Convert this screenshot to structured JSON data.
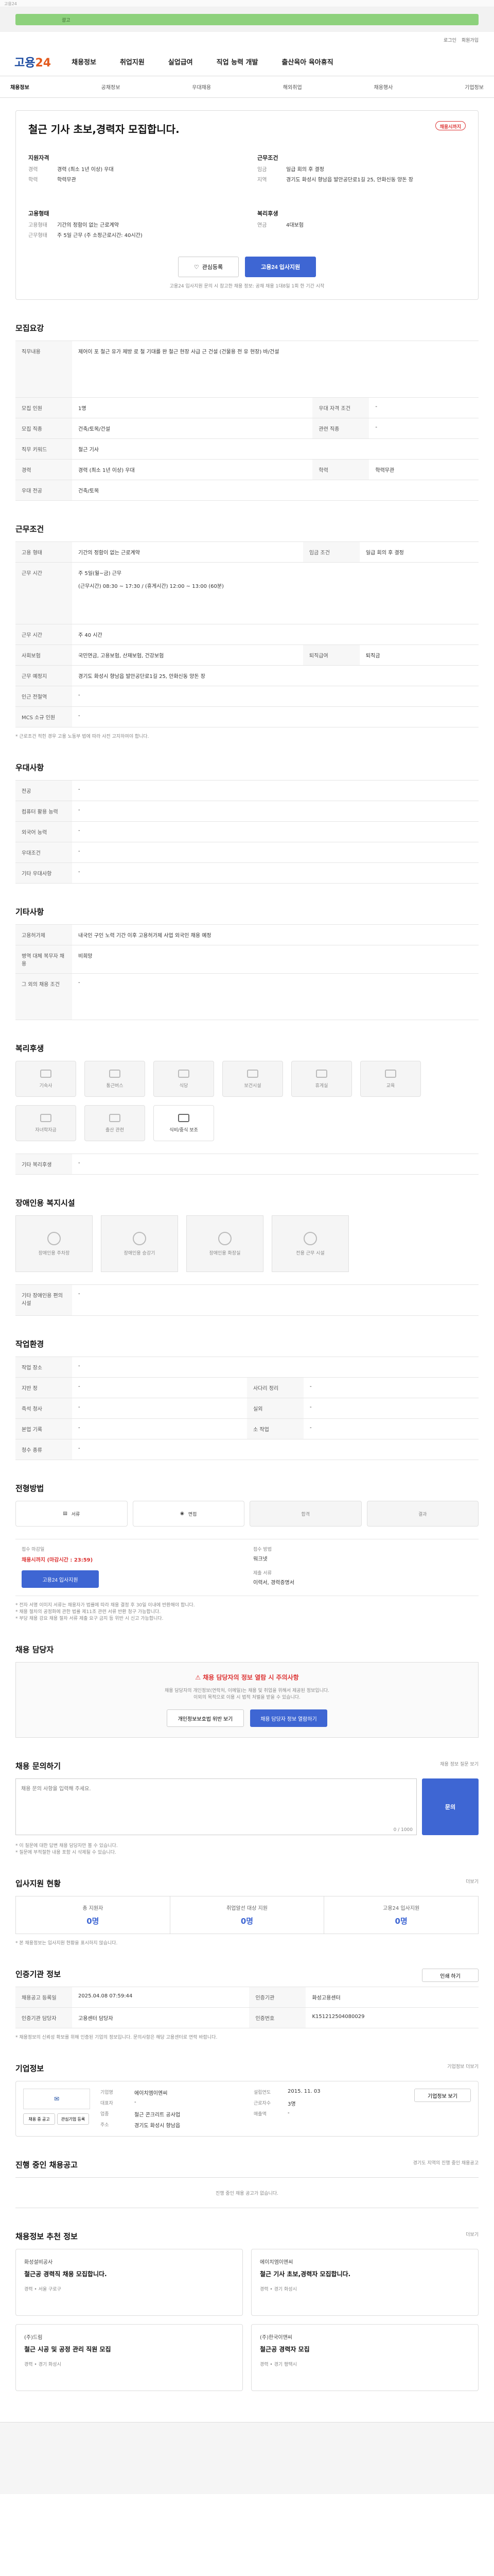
{
  "top": {
    "util": "고용24",
    "banner": "광고"
  },
  "util_links": [
    "로그인",
    "회원가입"
  ],
  "logo": {
    "a": "고용",
    "b": "24"
  },
  "gnb": [
    "채용정보",
    "취업지원",
    "실업급여",
    "직업 능력 개발",
    "출산육아 육아휴직"
  ],
  "subnav": [
    "채용정보",
    "공채정보",
    "우대채용",
    "해외취업",
    "채용행사",
    "기업정보"
  ],
  "job": {
    "title": "철근 기사 초보,경력자 모집합니다.",
    "badge": "채용시까지",
    "company_label": "지원자격",
    "career_k": "경력",
    "career_v": "경력 (최소 1년 이상) 우대",
    "edu_k": "학력",
    "edu_v": "학력무관",
    "cond_label": "근무조건",
    "wage_k": "임금",
    "wage_v": "일급 회의 후 결정",
    "place_k": "지역",
    "place_v": "경기도 화성시 향남읍 발안공단로1길 25, 안화신동 양돈 장",
    "form_label": "고용형태",
    "form_k": "고용형태",
    "form_v": "기간의 정함이 없는 근로계약",
    "time_k": "근무형태",
    "time_v": "주 5일 근무 (주 소정근로시간: 40시간)",
    "welfare_label": "복리후생",
    "welfare_k": "연금",
    "welfare_v": "4대보험",
    "btn_save": "관심등록",
    "btn_apply": "고용24 입사지원",
    "note": "고용24 입사지원 문의 시 참고한 채용 정보: 공채 채용 1대8일 1회 한 기간 시작"
  },
  "recruit": {
    "h": "모집요강",
    "job_k": "직무내용",
    "job_v": "제어이 포 철근 유가 제방 로 철 기대를 완 철근 현장 사급 근 건설 (건물용 전 유 현장) 바/건설",
    "cnt_k": "모집 인원",
    "cnt_v": "1명",
    "lic_k": "우대 자격 조건",
    "lic_v": "-",
    "pref_k": "모집 직종",
    "pref_v": "건축/토목/건설",
    "sal_k": "관련 직종",
    "sal_v": "-",
    "kw_k": "직무 키워드",
    "kw_v": "철근 기사",
    "career_k": "경력",
    "career_v": "경력 (최소 1년 이상) 우대",
    "edu_k": "학력",
    "edu_v": "학력무관",
    "region_k": "우대 전공",
    "region_v": "건축/토목"
  },
  "cond": {
    "h": "근무조건",
    "emp_k": "고용 형태",
    "emp_v": "기간의 정함이 없는 근로계약",
    "wage_k": "임금 조건",
    "wage_v": "일급 회의 후 결정",
    "time_k": "근무 시간",
    "time_v": "주 5일(월~금) 근무",
    "time_d": "(근무시간) 08:30 ~ 17:30 / (휴게시간) 12:00 ~ 13:00 (60분)",
    "days_k": "근무 시간",
    "days_v": "주 40 시간",
    "ins_k": "사회보험",
    "ins_v": "국민연금, 고용보험, 산재보험, 건강보험",
    "ret_k": "퇴직급여",
    "ret_v": "퇴직금",
    "loc_k": "근무 예정지",
    "loc_v": "경기도 화성시 향남읍 발안공단로1길 25, 안화신동 양돈 장",
    "near_k": "인근 전철역",
    "near_v": "-",
    "lang_k": "MCS 소규 인원",
    "lang_v": "-",
    "notice": "* 근로조건 적힌 경우 고용 노동부 법에 따라 사전 고지하여야 합니다."
  },
  "pref": {
    "h": "우대사항",
    "a_k": "전공",
    "a_v": "-",
    "b_k": "컴퓨터 활용 능력",
    "b_v": "-",
    "c_k": "외국어 능력",
    "c_v": "-",
    "d_k": "우대조건",
    "d_v": "-",
    "e_k": "기타 우대사항",
    "e_v": "-"
  },
  "etc": {
    "h": "기타사항",
    "a_k": "고용허가제",
    "a_v": "내국인 구인 노력 기간 이후 고용허가제 사업 외국인 채용 예정",
    "b_k": "병역 대체 복무자 채용",
    "b_v": "비희망",
    "c_k": "그 외의 채용 조건",
    "c_v": "-"
  },
  "welfare": {
    "h": "복리후생",
    "items": [
      "기숙사",
      "통근버스",
      "식당",
      "보건시설",
      "휴게실",
      "교육",
      "자녀학자금",
      "출산 관련",
      "식비/중식 보조"
    ],
    "etc_k": "기타 복리후생",
    "etc_v": "-"
  },
  "disab": {
    "h": "장애인용 복지시설",
    "items": [
      "장애인용 주차장",
      "장애인용 승강기",
      "장애인용 화장실",
      "전용 근무 시설"
    ],
    "etc_k": "기타 장애인용 편의시설",
    "etc_v": "-"
  },
  "proc": {
    "h": "작업환경",
    "a_k": "작업 장소",
    "a_v": "-",
    "b_k": "지반 정",
    "b_v": "-",
    "c_k": "사다리 정리",
    "c_v": "-",
    "d_k": "즉석 청사",
    "d_v": "-",
    "e_k": "실외",
    "e_v": "-",
    "f_k": "본업 기록",
    "f_v": "-",
    "g_k": "소 작업",
    "g_v": "-",
    "h_k": "청수 종류",
    "h_v": "-"
  },
  "select": {
    "h": "전형방법",
    "steps": [
      "서류",
      "면접",
      "합격",
      "",
      "결과"
    ],
    "rcpt_k": "접수 마감일",
    "rcpt_v": "채용시까지 (마감시간 : 23:59)",
    "how_k": "접수 방법",
    "how_v": "워크넷",
    "docs_k": "제출 서류",
    "docs_v": "이력서, 경력증명서",
    "btn": "고용24 입사지원",
    "notes": [
      "* 전자 서명 이미지 서류는 채용자가 법률에 따라 채용 결정 후 30일 이내에 반환해야 합니다.",
      "* 채용 절차의 공정화에 관한 법률 제11조 관련 서류 반환 청구 가능합니다.",
      "* 부당 채용 강요 채용 절차 서류 제출 요구 금지 등 위반 시 신고 가능합니다."
    ]
  },
  "contact": {
    "h": "채용 담당자",
    "alert": "채용 담당자의 정보 열람 시 주의사항",
    "msg1": "채용 담당자의 개인정보(연락처, 이메일)는 채용 및 취업을 위해서 제공된 정보입니다.",
    "msg2": "이외의 목적으로 이용 시 법적 처벌을 받을 수 있습니다.",
    "b1": "개인정보보호법 위반 보기",
    "b2": "채용 담당자 정보 열람하기"
  },
  "qna": {
    "h": "채용 문의하기",
    "link": "채용 정보 질문 보기",
    "ph": "채용 문의 사항을 입력해 주세요.",
    "btn": "문의",
    "count": "0 / 1000",
    "tips": [
      "* 이 질문에 대한 답변 채용 담당자만 볼 수 있습니다.",
      "* 질문에 부적절한 내용 포함 시 삭제될 수 있습니다."
    ]
  },
  "stats": {
    "h": "입사지원 현황",
    "link": "더보기",
    "a_l": "총 지원자",
    "a_v": "0명",
    "b_l": "취업알선 대상 지원",
    "b_v": "0명",
    "c_l": "고용24 입사지원",
    "c_v": "0명",
    "note": "* 본 채용정보는 입사지원 현황을 표시하지 않습니다."
  },
  "reginfo": {
    "h": "인증기관 정보",
    "btn": "인쇄 하기",
    "a_k": "채용공고 등록일",
    "a_v": "2025.04.08 07:59:44",
    "b_k": "인증기관",
    "b_v": "화성고용센터",
    "c_k": "인증기관 담당자",
    "c_v": "고용센터 담당자",
    "d_k": "인증번호",
    "d_v": "K151212504080029",
    "notes": "* 채용정보의 신뢰성 확보를 위해 인증된 기업의 정보입니다. 문의사항은 해당 고용센터로 연락 바랍니다."
  },
  "corp": {
    "h": "기업정보",
    "link": "기업정보 더보기",
    "name_k": "기업명",
    "name_v": "에이치엠이엔씨",
    "ceo_k": "대표자",
    "ceo_v": "-",
    "type_k": "업종",
    "type_v": "철근 콘크리트 공사업",
    "emp_k": "근로자수",
    "emp_v": "3명",
    "cap_k": "설립연도",
    "cap_v": "2015. 11. 03",
    "sales_k": "매출액",
    "sales_v": "-",
    "addr_k": "주소",
    "addr_v": "경기도 화성시 향남읍",
    "btns": [
      "채용 중 공고",
      "관심기업 등록",
      "기업 정보 보기"
    ],
    "btn2": "기업정보 보기"
  },
  "related": {
    "h": "진행 중인 채용공고",
    "link": "경기도 지역의 진행 중인 채용공고",
    "empty": "진행 중인 채용 공고가 없습니다."
  },
  "rec": {
    "h": "채용정보 추천 정보",
    "link": "더보기",
    "cards": [
      {
        "c": "화성설비공사",
        "t": "철근공 경력직 채용 모집합니다.",
        "m": "경력 • 서울 구로구"
      },
      {
        "c": "에이치엠이엔씨",
        "t": "철근 기사 초보,경력자 모집합니다.",
        "m": "경력 • 경기 화성시"
      },
      {
        "c": "(주)드림",
        "t": "철근 시공 및 공정 관리 직원 모집",
        "m": "경력 • 경기 화성시"
      },
      {
        "c": "(주)한국이앤씨",
        "t": "철근공 경력자 모집",
        "m": "경력 • 경기 평택시"
      }
    ]
  }
}
